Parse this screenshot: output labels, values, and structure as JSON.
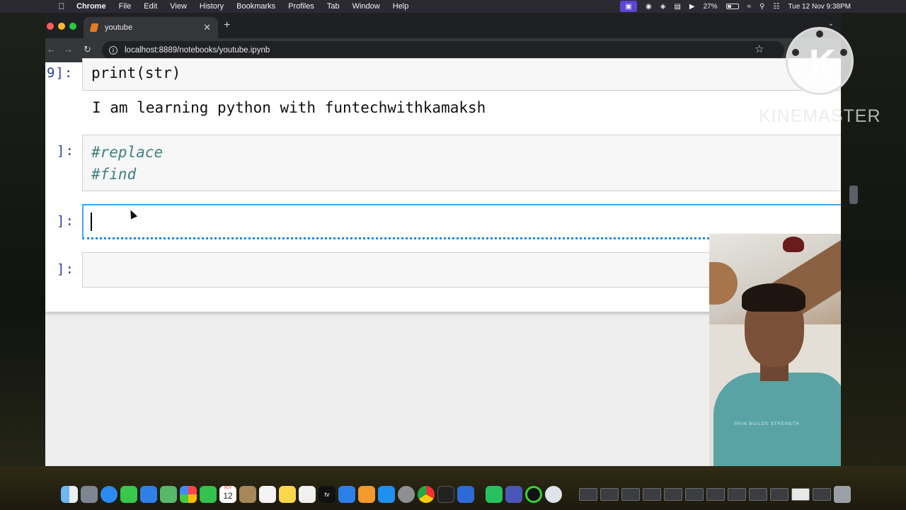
{
  "menubar": {
    "app_name": "Chrome",
    "menus": [
      "File",
      "Edit",
      "View",
      "History",
      "Bookmarks",
      "Profiles",
      "Tab",
      "Window",
      "Help"
    ],
    "battery_percent": "27%",
    "datetime": "Tue 12 Nov  9:38PM"
  },
  "browser": {
    "tab_title": "youtube",
    "url": "localhost:8889/notebooks/youtube.ipynb",
    "colors": {
      "tab_bg": "#35363a",
      "strip_bg": "#1f2023",
      "close": "#ff5f57",
      "min": "#febc2e",
      "max": "#28c840"
    }
  },
  "notebook": {
    "cells": [
      {
        "prompt": "9]:",
        "code": "print(str)",
        "output": "I am learning python with funtechwithkamaksh"
      },
      {
        "prompt": "]:",
        "code_lines": [
          "#replace",
          "#find"
        ]
      },
      {
        "prompt": "]:",
        "code": "",
        "active": true
      },
      {
        "prompt": "]:",
        "code": ""
      }
    ],
    "colors": {
      "prompt": "#303f9f",
      "comment": "#408080",
      "active_border": "#42a5f5"
    }
  },
  "watermark": {
    "text": "KINEMASTER"
  },
  "webcam": {
    "shirt_text": "PAIN  BUILDS  STRENGTH"
  },
  "dock": {
    "icons": [
      "finder-icon",
      "launchpad-icon",
      "safari-icon",
      "messages-icon",
      "mail-icon",
      "maps-icon",
      "photos-icon",
      "facetime-icon",
      "calendar-icon",
      "contacts-icon",
      "reminders-icon",
      "notes-icon",
      "freeform-icon",
      "tv-icon",
      "keynote-icon",
      "pages-icon",
      "app-store-icon",
      "system-settings-icon",
      "chrome-icon",
      "terminal-icon",
      "screen-sharing-icon",
      "whatsapp-icon",
      "vpn-icon",
      "activity-icon",
      "quicktime-icon"
    ],
    "calendar_day": "12",
    "calendar_month": "NOV",
    "tv_label": "tv"
  }
}
